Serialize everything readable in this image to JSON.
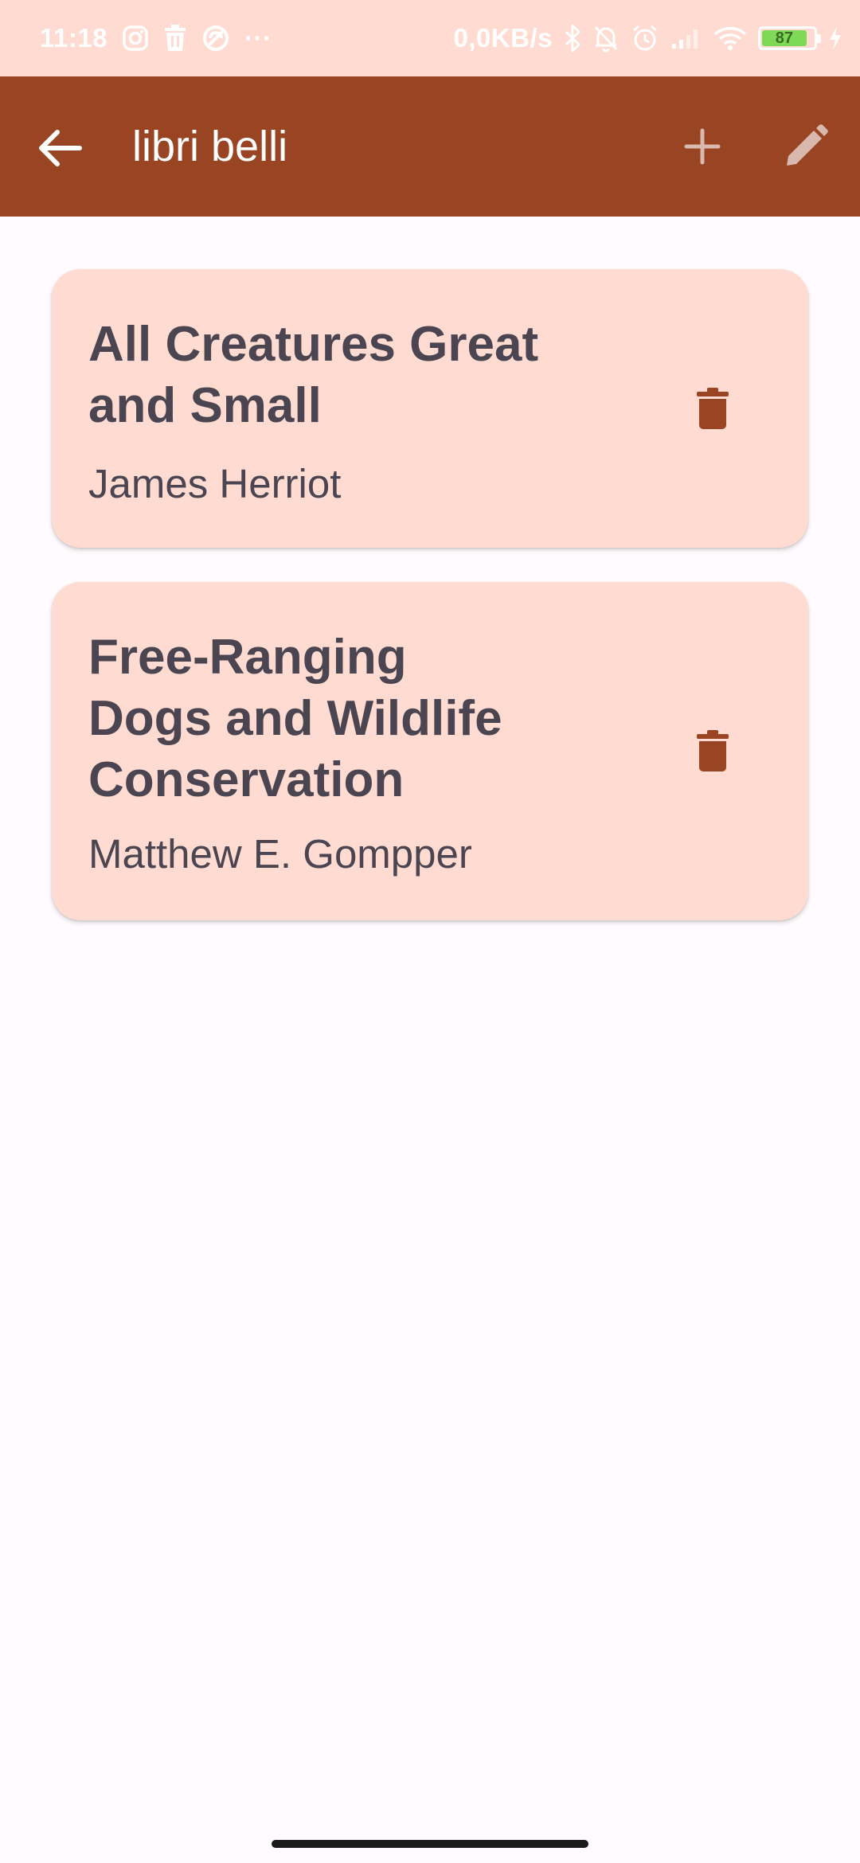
{
  "status_bar": {
    "time": "11:18",
    "more": "···",
    "network_speed": "0,0KB/s",
    "battery_level": "87"
  },
  "app_bar": {
    "title": "libri belli",
    "icons": [
      "arrow-back-icon",
      "plus-icon",
      "pencil-icon"
    ]
  },
  "books": [
    {
      "title": "All Creatures Great and Small",
      "author": "James Herriot"
    },
    {
      "title": "Free-Ranging Dogs and Wildlife Conservation",
      "author": "Matthew E. Gompper"
    }
  ],
  "colors": {
    "status_bar_bg": "#ffdbd1",
    "app_bar_bg": "#994422",
    "card_bg": "#ffdbd1",
    "delete_icon": "#994422",
    "text": "#4a4550",
    "page_bg": "#fffbfe"
  }
}
